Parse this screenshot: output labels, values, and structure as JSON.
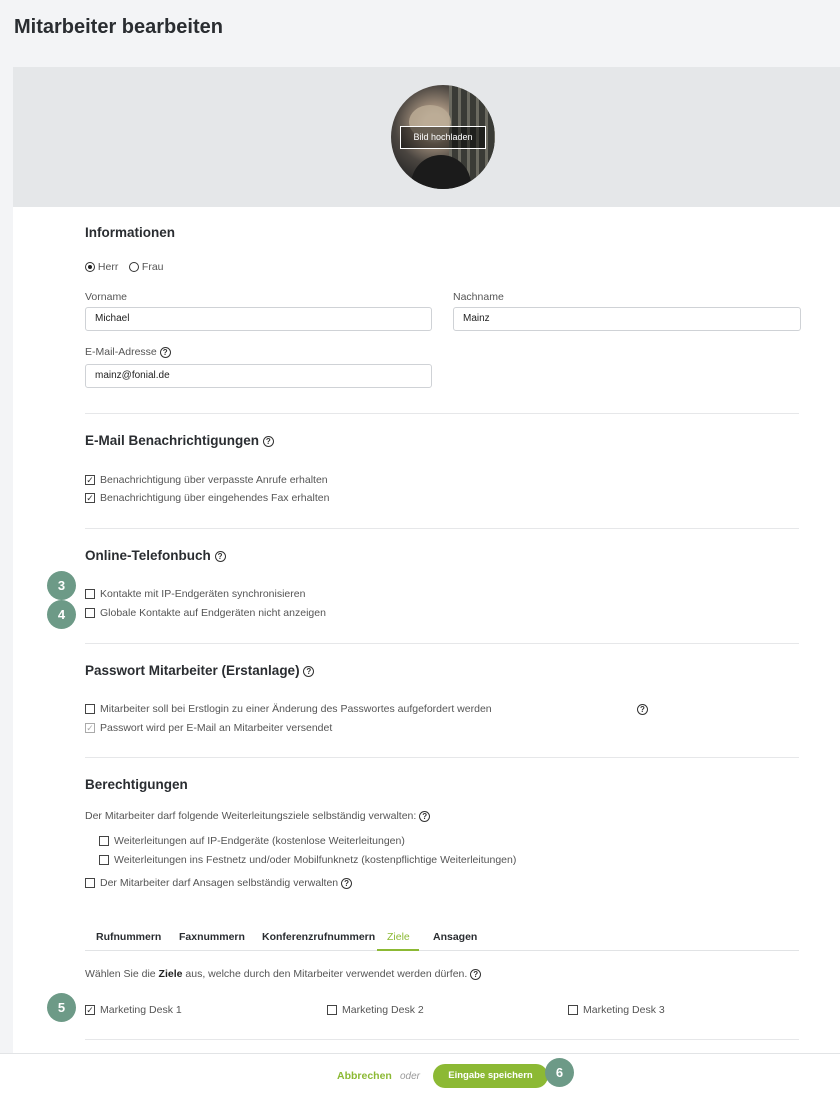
{
  "page_title": "Mitarbeiter bearbeiten",
  "upload_label": "Bild hochladen",
  "info": {
    "title": "Informationen",
    "salutation": {
      "herr": "Herr",
      "frau": "Frau",
      "selected": "Herr"
    },
    "vorname_label": "Vorname",
    "vorname_value": "Michael",
    "nachname_label": "Nachname",
    "nachname_value": "Mainz",
    "email_label": "E-Mail-Adresse",
    "email_value": "mainz@fonial.de"
  },
  "notifications": {
    "title": "E-Mail Benachrichtigungen",
    "items": [
      {
        "label": "Benachrichtigung über verpasste Anrufe erhalten",
        "checked": true
      },
      {
        "label": "Benachrichtigung über eingehendes Fax erhalten",
        "checked": true
      }
    ]
  },
  "phonebook": {
    "title": "Online-Telefonbuch",
    "items": [
      {
        "label": "Kontakte mit IP-Endgeräten synchronisieren",
        "checked": false
      },
      {
        "label": "Globale Kontakte auf Endgeräten nicht anzeigen",
        "checked": false
      }
    ]
  },
  "password": {
    "title": "Passwort Mitarbeiter (Erstanlage)",
    "items": [
      {
        "label": "Mitarbeiter soll bei Erstlogin zu einer Änderung des Passwortes aufgefordert werden",
        "checked": false
      },
      {
        "label": "Passwort wird per E-Mail an Mitarbeiter versendet",
        "checked": true,
        "disabled": true
      }
    ]
  },
  "permissions": {
    "title": "Berechtigungen",
    "intro": "Der Mitarbeiter darf folgende Weiterleitungsziele selbständig verwalten:",
    "forwarding": [
      {
        "label": "Weiterleitungen auf IP-Endgeräte (kostenlose Weiterleitungen)",
        "checked": false
      },
      {
        "label": "Weiterleitungen ins Festnetz und/oder Mobilfunknetz (kostenpflichtige Weiterleitungen)",
        "checked": false
      }
    ],
    "announcements": {
      "label": "Der Mitarbeiter darf Ansagen selbständig verwalten",
      "checked": false
    }
  },
  "tabs": [
    {
      "label": "Rufnummern",
      "active": false
    },
    {
      "label": "Faxnummern",
      "active": false
    },
    {
      "label": "Konferenzrufnummern",
      "active": false
    },
    {
      "label": "Ziele",
      "active": true
    },
    {
      "label": "Ansagen",
      "active": false
    }
  ],
  "targets": {
    "intro_pre": "Wählen Sie die ",
    "intro_bold": "Ziele",
    "intro_post": " aus, welche durch den Mitarbeiter verwendet werden dürfen.",
    "items": [
      {
        "label": "Marketing Desk 1",
        "checked": true
      },
      {
        "label": "Marketing Desk 2",
        "checked": false
      },
      {
        "label": "Marketing Desk 3",
        "checked": false
      }
    ]
  },
  "badges": [
    "3",
    "4",
    "5",
    "6"
  ],
  "footer": {
    "cancel": "Abbrechen",
    "or": "oder",
    "save": "Eingabe speichern"
  },
  "colors": {
    "accent": "#8cb934",
    "badge": "#6d9a87",
    "banner": "#e5e7e9"
  }
}
